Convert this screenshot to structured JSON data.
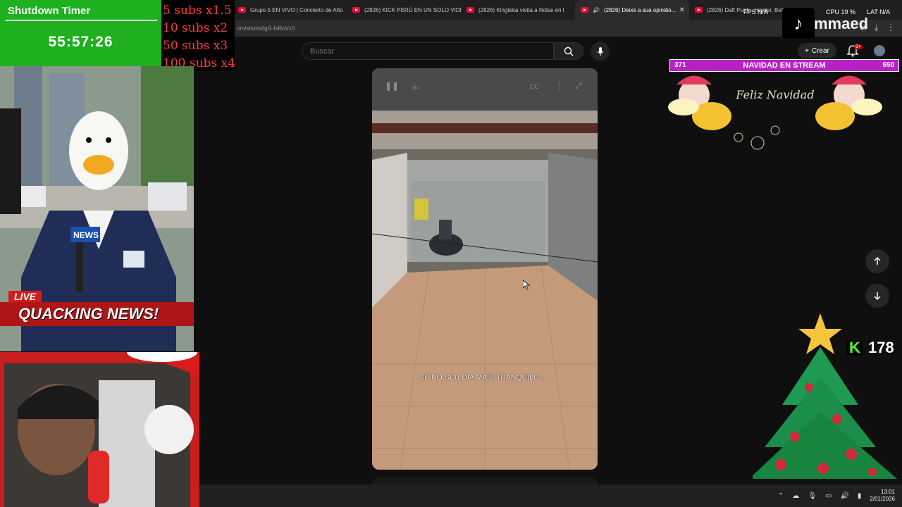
{
  "browser": {
    "tabs": [
      {
        "title": "Grupo 5 EN VIVO | Concierto de Año",
        "active": false
      },
      {
        "title": "(2826) KICK PERÚ EN UN SOLO VIDE",
        "active": false
      },
      {
        "title": "(2826) Kingteka visita a Rolas en l",
        "active": false
      },
      {
        "title": "(2826) Deixe a sua opinião...",
        "active": true
      },
      {
        "title": "(2826) Daft Punk - Harder, Bett",
        "active": false
      }
    ],
    "url": "om/shorts/lgG-fsRsVx0"
  },
  "youtube": {
    "search_placeholder": "Buscar",
    "create_label": "Crear",
    "notification_count": "9+",
    "video_caption": "SP NO SEU DIA MAIS TRANQUILO ...."
  },
  "overlays": {
    "timer": {
      "title": "Shutdown Timer",
      "value": "55:57:26"
    },
    "multipliers": [
      "5 subs x1.5",
      "10 subs x2",
      "50 subs x3",
      "100 subs x4"
    ],
    "news": {
      "live": "LIVE",
      "headline": "QUACKING NEWS!",
      "mic_label": "NEWS"
    },
    "tiktok": {
      "logo": "♪",
      "username": "mmaed"
    },
    "stats": {
      "fps": "FPS N/A",
      "cpu": "CPU 19 %",
      "lat": "LAT N/A"
    },
    "navidad": {
      "label": "NAVIDAD EN STREAM",
      "left_value": "371",
      "right_value": "650"
    },
    "greeting": "Feliz Navidad",
    "kick": {
      "logo": "K",
      "count": "178"
    }
  },
  "taskbar": {
    "time": "13:01",
    "date": "2/01/2026"
  }
}
